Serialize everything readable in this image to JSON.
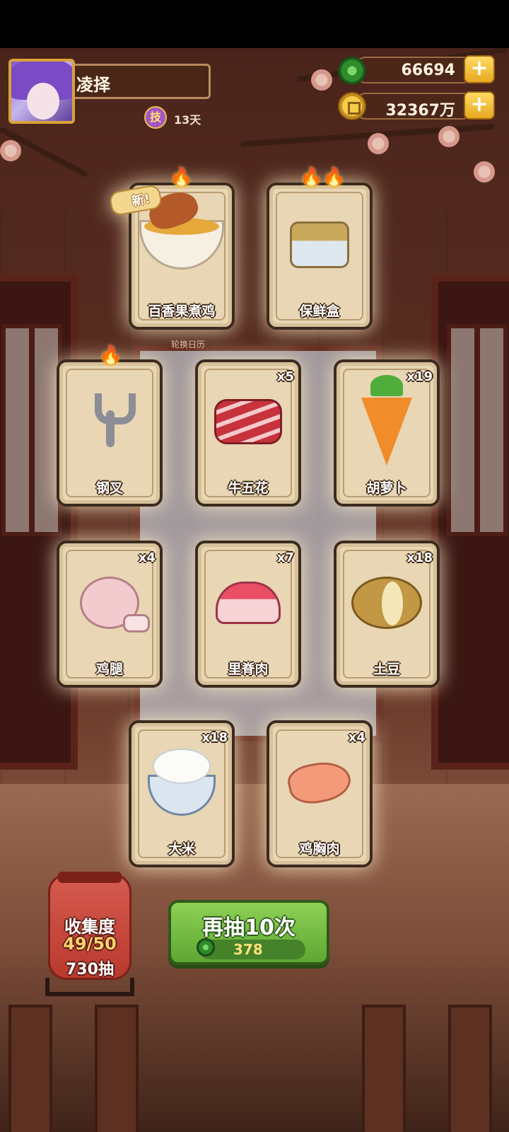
{
  "player": {
    "name": "凌择",
    "skill_badge": "技",
    "skill_days": "13天"
  },
  "currencies": {
    "jade": {
      "value": "66694",
      "icon": "jade-icon"
    },
    "coin": {
      "value": "32367万",
      "icon": "coin-icon"
    },
    "plus_label": "+"
  },
  "cards": [
    {
      "name": "百香果煮鸡",
      "count": "",
      "new_tag": "新!",
      "flames": "🔥",
      "art": "chicken-soup-icon"
    },
    {
      "name": "保鲜盒",
      "count": "",
      "new_tag": "",
      "flames": "🔥🔥",
      "art": "food-container-icon"
    },
    {
      "name": "钢叉",
      "count": "",
      "new_tag": "",
      "flames": "🔥",
      "art": "fork-icon"
    },
    {
      "name": "牛五花",
      "count": "x5",
      "new_tag": "",
      "flames": "",
      "art": "beef-icon"
    },
    {
      "name": "胡萝卜",
      "count": "x19",
      "new_tag": "",
      "flames": "",
      "art": "carrot-icon"
    },
    {
      "name": "鸡腿",
      "count": "x4",
      "new_tag": "",
      "flames": "",
      "art": "drumstick-icon"
    },
    {
      "name": "里脊肉",
      "count": "x7",
      "new_tag": "",
      "flames": "",
      "art": "loin-icon"
    },
    {
      "name": "土豆",
      "count": "x18",
      "new_tag": "",
      "flames": "",
      "art": "potato-icon"
    },
    {
      "name": "大米",
      "count": "x18",
      "new_tag": "",
      "flames": "",
      "art": "rice-icon"
    },
    {
      "name": "鸡胸肉",
      "count": "x4",
      "new_tag": "",
      "flames": "",
      "art": "chicken-breast-icon"
    }
  ],
  "background_label": "轮换日历",
  "collection": {
    "title": "收集度",
    "progress": "49/50",
    "draws": "730抽"
  },
  "draw_button": {
    "label": "再抽10次",
    "cost": "378"
  },
  "colors": {
    "draw_button": "#6fba3f",
    "lantern": "#c8463a",
    "card_bg": "#e8d6b4"
  }
}
